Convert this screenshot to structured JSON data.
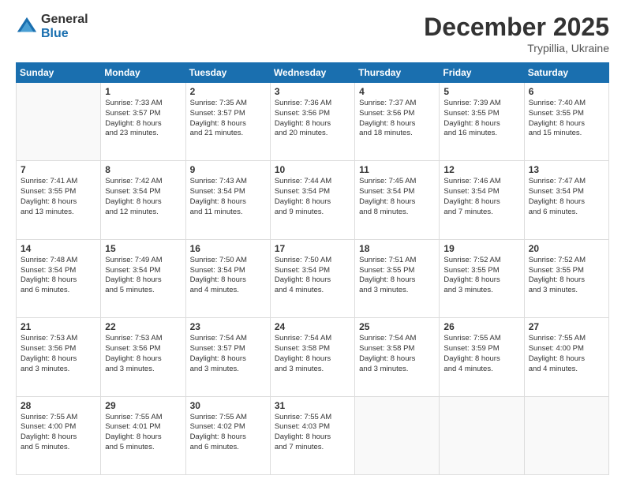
{
  "header": {
    "logo_general": "General",
    "logo_blue": "Blue",
    "title": "December 2025",
    "subtitle": "Trypillia, Ukraine"
  },
  "calendar": {
    "headers": [
      "Sunday",
      "Monday",
      "Tuesday",
      "Wednesday",
      "Thursday",
      "Friday",
      "Saturday"
    ],
    "weeks": [
      [
        {
          "day": "",
          "info": ""
        },
        {
          "day": "1",
          "info": "Sunrise: 7:33 AM\nSunset: 3:57 PM\nDaylight: 8 hours\nand 23 minutes."
        },
        {
          "day": "2",
          "info": "Sunrise: 7:35 AM\nSunset: 3:57 PM\nDaylight: 8 hours\nand 21 minutes."
        },
        {
          "day": "3",
          "info": "Sunrise: 7:36 AM\nSunset: 3:56 PM\nDaylight: 8 hours\nand 20 minutes."
        },
        {
          "day": "4",
          "info": "Sunrise: 7:37 AM\nSunset: 3:56 PM\nDaylight: 8 hours\nand 18 minutes."
        },
        {
          "day": "5",
          "info": "Sunrise: 7:39 AM\nSunset: 3:55 PM\nDaylight: 8 hours\nand 16 minutes."
        },
        {
          "day": "6",
          "info": "Sunrise: 7:40 AM\nSunset: 3:55 PM\nDaylight: 8 hours\nand 15 minutes."
        }
      ],
      [
        {
          "day": "7",
          "info": "Sunrise: 7:41 AM\nSunset: 3:55 PM\nDaylight: 8 hours\nand 13 minutes."
        },
        {
          "day": "8",
          "info": "Sunrise: 7:42 AM\nSunset: 3:54 PM\nDaylight: 8 hours\nand 12 minutes."
        },
        {
          "day": "9",
          "info": "Sunrise: 7:43 AM\nSunset: 3:54 PM\nDaylight: 8 hours\nand 11 minutes."
        },
        {
          "day": "10",
          "info": "Sunrise: 7:44 AM\nSunset: 3:54 PM\nDaylight: 8 hours\nand 9 minutes."
        },
        {
          "day": "11",
          "info": "Sunrise: 7:45 AM\nSunset: 3:54 PM\nDaylight: 8 hours\nand 8 minutes."
        },
        {
          "day": "12",
          "info": "Sunrise: 7:46 AM\nSunset: 3:54 PM\nDaylight: 8 hours\nand 7 minutes."
        },
        {
          "day": "13",
          "info": "Sunrise: 7:47 AM\nSunset: 3:54 PM\nDaylight: 8 hours\nand 6 minutes."
        }
      ],
      [
        {
          "day": "14",
          "info": "Sunrise: 7:48 AM\nSunset: 3:54 PM\nDaylight: 8 hours\nand 6 minutes."
        },
        {
          "day": "15",
          "info": "Sunrise: 7:49 AM\nSunset: 3:54 PM\nDaylight: 8 hours\nand 5 minutes."
        },
        {
          "day": "16",
          "info": "Sunrise: 7:50 AM\nSunset: 3:54 PM\nDaylight: 8 hours\nand 4 minutes."
        },
        {
          "day": "17",
          "info": "Sunrise: 7:50 AM\nSunset: 3:54 PM\nDaylight: 8 hours\nand 4 minutes."
        },
        {
          "day": "18",
          "info": "Sunrise: 7:51 AM\nSunset: 3:55 PM\nDaylight: 8 hours\nand 3 minutes."
        },
        {
          "day": "19",
          "info": "Sunrise: 7:52 AM\nSunset: 3:55 PM\nDaylight: 8 hours\nand 3 minutes."
        },
        {
          "day": "20",
          "info": "Sunrise: 7:52 AM\nSunset: 3:55 PM\nDaylight: 8 hours\nand 3 minutes."
        }
      ],
      [
        {
          "day": "21",
          "info": "Sunrise: 7:53 AM\nSunset: 3:56 PM\nDaylight: 8 hours\nand 3 minutes."
        },
        {
          "day": "22",
          "info": "Sunrise: 7:53 AM\nSunset: 3:56 PM\nDaylight: 8 hours\nand 3 minutes."
        },
        {
          "day": "23",
          "info": "Sunrise: 7:54 AM\nSunset: 3:57 PM\nDaylight: 8 hours\nand 3 minutes."
        },
        {
          "day": "24",
          "info": "Sunrise: 7:54 AM\nSunset: 3:58 PM\nDaylight: 8 hours\nand 3 minutes."
        },
        {
          "day": "25",
          "info": "Sunrise: 7:54 AM\nSunset: 3:58 PM\nDaylight: 8 hours\nand 3 minutes."
        },
        {
          "day": "26",
          "info": "Sunrise: 7:55 AM\nSunset: 3:59 PM\nDaylight: 8 hours\nand 4 minutes."
        },
        {
          "day": "27",
          "info": "Sunrise: 7:55 AM\nSunset: 4:00 PM\nDaylight: 8 hours\nand 4 minutes."
        }
      ],
      [
        {
          "day": "28",
          "info": "Sunrise: 7:55 AM\nSunset: 4:00 PM\nDaylight: 8 hours\nand 5 minutes."
        },
        {
          "day": "29",
          "info": "Sunrise: 7:55 AM\nSunset: 4:01 PM\nDaylight: 8 hours\nand 5 minutes."
        },
        {
          "day": "30",
          "info": "Sunrise: 7:55 AM\nSunset: 4:02 PM\nDaylight: 8 hours\nand 6 minutes."
        },
        {
          "day": "31",
          "info": "Sunrise: 7:55 AM\nSunset: 4:03 PM\nDaylight: 8 hours\nand 7 minutes."
        },
        {
          "day": "",
          "info": ""
        },
        {
          "day": "",
          "info": ""
        },
        {
          "day": "",
          "info": ""
        }
      ]
    ]
  }
}
